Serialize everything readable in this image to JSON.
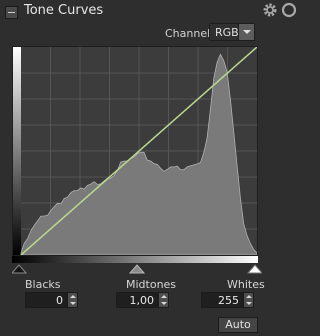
{
  "panel": {
    "title": "Tone Curves"
  },
  "header": {
    "icons": [
      "gear-icon",
      "reset-icon"
    ]
  },
  "channel": {
    "label": "Channel:",
    "value": "RGB"
  },
  "levels": {
    "blacks": {
      "label": "Blacks",
      "value": "0",
      "fraction": 0.0
    },
    "midtones": {
      "label": "Midtones",
      "value": "1,00",
      "fraction": 0.5
    },
    "whites": {
      "label": "Whites",
      "value": "255",
      "fraction": 1.0
    }
  },
  "auto_button": {
    "label": "Auto"
  },
  "histogram": {
    "bins": [
      0.02,
      0.05,
      0.09,
      0.12,
      0.15,
      0.17,
      0.19,
      0.2,
      0.22,
      0.24,
      0.25,
      0.27,
      0.28,
      0.29,
      0.3,
      0.31,
      0.31,
      0.32,
      0.33,
      0.33,
      0.34,
      0.35,
      0.36,
      0.37,
      0.38,
      0.39,
      0.4,
      0.41,
      0.42,
      0.44,
      0.45,
      0.46,
      0.47,
      0.48,
      0.49,
      0.5,
      0.5,
      0.5,
      0.49,
      0.48,
      0.47,
      0.46,
      0.45,
      0.44,
      0.44,
      0.43,
      0.44,
      0.44,
      0.43,
      0.43,
      0.44,
      0.45,
      0.46,
      0.47,
      0.48,
      0.52,
      0.6,
      0.75,
      0.9,
      0.98,
      1.0,
      0.97,
      0.9,
      0.78,
      0.62,
      0.45,
      0.28,
      0.18,
      0.12,
      0.08,
      0.05,
      0.03
    ],
    "accent_color": "#bcd88e"
  }
}
